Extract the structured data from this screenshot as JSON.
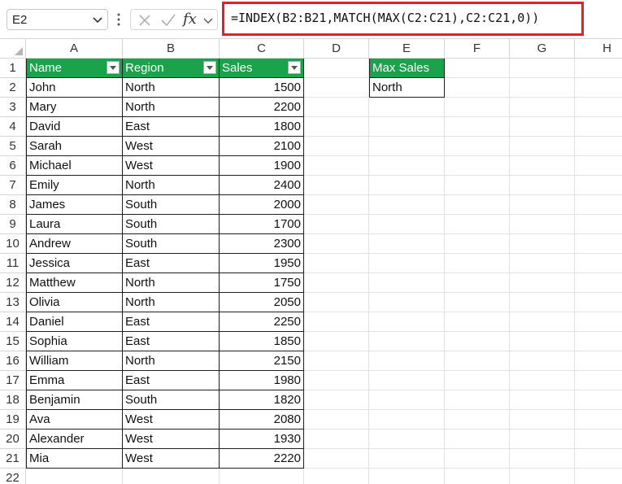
{
  "name_box": {
    "value": "E2"
  },
  "formula_bar": {
    "fx_label": "fx",
    "formula": "=INDEX(B2:B21,MATCH(MAX(C2:C21),C2:C21,0))"
  },
  "columns": [
    "A",
    "B",
    "C",
    "D",
    "E",
    "F",
    "G",
    "H"
  ],
  "rows": [
    "1",
    "2",
    "3",
    "4",
    "5",
    "6",
    "7",
    "8",
    "9",
    "10",
    "11",
    "12",
    "13",
    "14",
    "15",
    "16",
    "17",
    "18",
    "19",
    "20",
    "21",
    "22"
  ],
  "table": {
    "headers": [
      "Name",
      "Region",
      "Sales"
    ],
    "rows": [
      [
        "John",
        "North",
        "1500"
      ],
      [
        "Mary",
        "North",
        "2200"
      ],
      [
        "David",
        "East",
        "1800"
      ],
      [
        "Sarah",
        "West",
        "2100"
      ],
      [
        "Michael",
        "West",
        "1900"
      ],
      [
        "Emily",
        "North",
        "2400"
      ],
      [
        "James",
        "South",
        "2000"
      ],
      [
        "Laura",
        "South",
        "1700"
      ],
      [
        "Andrew",
        "South",
        "2300"
      ],
      [
        "Jessica",
        "East",
        "1950"
      ],
      [
        "Matthew",
        "North",
        "1750"
      ],
      [
        "Olivia",
        "North",
        "2050"
      ],
      [
        "Daniel",
        "East",
        "2250"
      ],
      [
        "Sophia",
        "East",
        "1850"
      ],
      [
        "William",
        "North",
        "2150"
      ],
      [
        "Emma",
        "East",
        "1980"
      ],
      [
        "Benjamin",
        "South",
        "1820"
      ],
      [
        "Ava",
        "West",
        "2080"
      ],
      [
        "Alexander",
        "West",
        "1930"
      ],
      [
        "Mia",
        "West",
        "2220"
      ]
    ]
  },
  "result": {
    "header": "Max Sales",
    "value": "North"
  },
  "colors": {
    "header_fill": "#1aa34a",
    "highlight_border": "#e2202a"
  }
}
